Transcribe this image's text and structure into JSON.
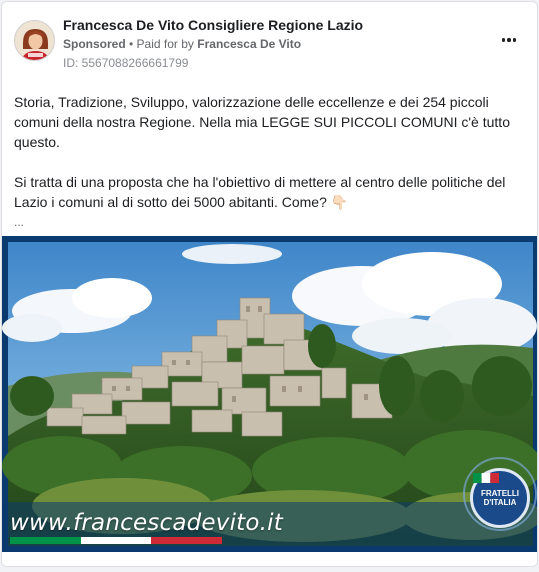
{
  "post": {
    "page_name": "Francesca De Vito Consigliere Regione Lazio",
    "sponsored_label": "Sponsored",
    "separator": " • ",
    "paid_for_prefix": "Paid for by",
    "paid_for_name": "Francesca De Vito",
    "ad_id": "ID: 5567088266661799",
    "more_icon": "more-horizontal-icon",
    "text_paragraph_1": "Storia, Tradizione, Sviluppo, valorizzazione delle eccellenze e dei 254 piccoli comuni della nostra Regione. Nella mia LEGGE SUI PICCOLI COMUNI c'è tutto questo.",
    "text_paragraph_2": "Si tratta di una proposta che ha l'obiettivo di mettere al centro delle politiche del Lazio i comuni al di sotto dei 5000 abitanti. Come? 👇🏻",
    "see_more": "..."
  },
  "media": {
    "url_text": "www.francescadevito.it",
    "badge_text": "FRATELLI D'ITALIA",
    "flag_colors": [
      "#009246",
      "#ffffff",
      "#ce2b37"
    ],
    "frame_color": "#0b3a6e"
  },
  "colors": {
    "text_primary": "#1c1e21",
    "text_secondary": "#65676b",
    "card_border": "#dddfe2"
  }
}
